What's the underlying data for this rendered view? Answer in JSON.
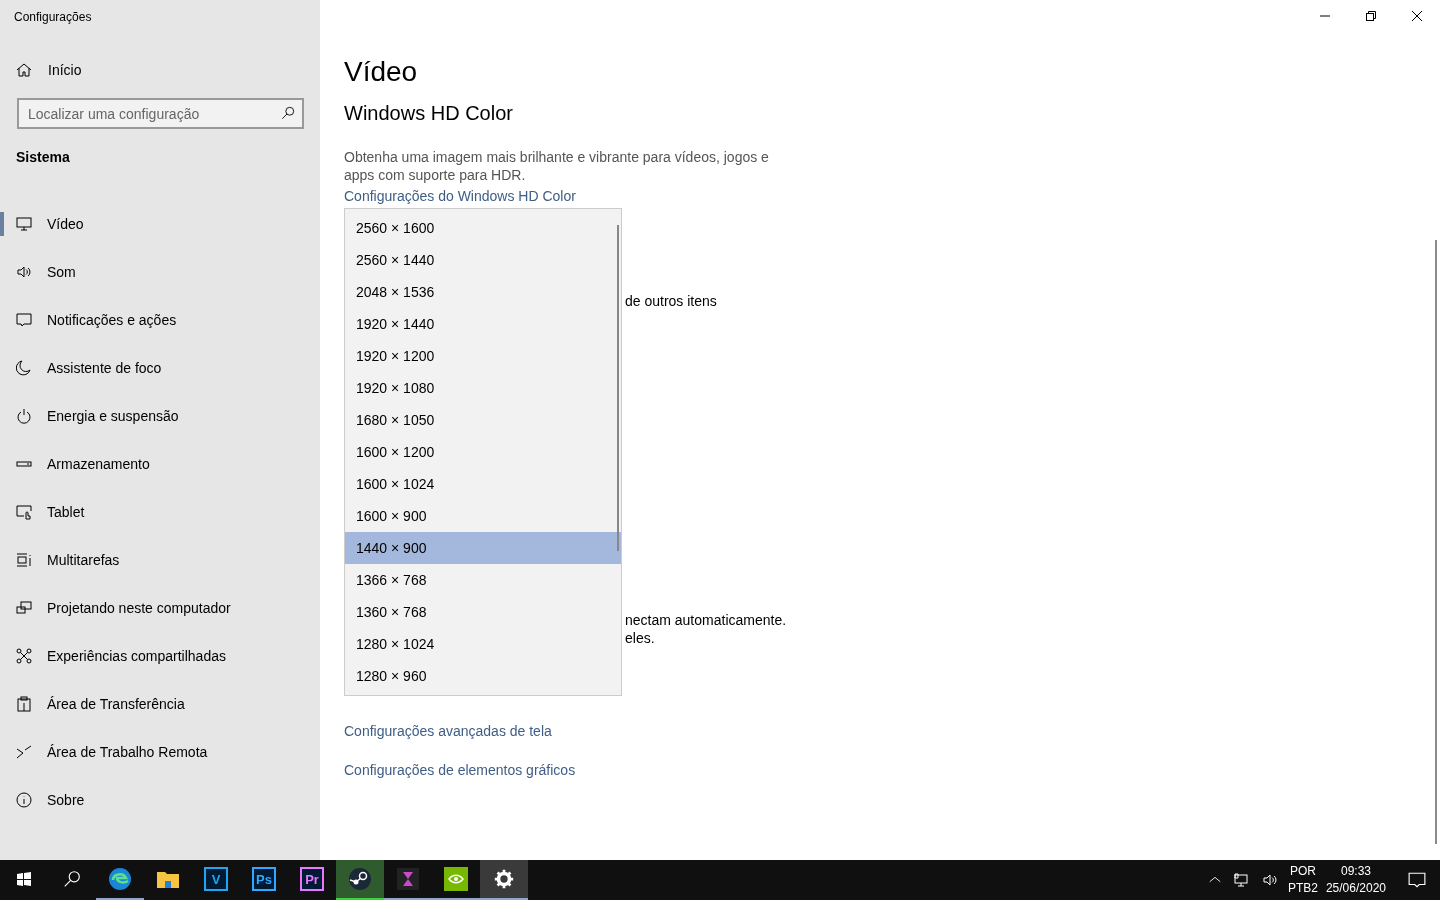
{
  "window": {
    "title": "Configurações"
  },
  "sidebar": {
    "home": "Início",
    "search": {
      "placeholder": "Localizar uma configuração"
    },
    "section": "Sistema",
    "items": [
      {
        "label": "Vídeo",
        "selected": true
      },
      {
        "label": "Som",
        "selected": false
      },
      {
        "label": "Notificações e ações",
        "selected": false
      },
      {
        "label": "Assistente de foco",
        "selected": false
      },
      {
        "label": "Energia e suspensão",
        "selected": false
      },
      {
        "label": "Armazenamento",
        "selected": false
      },
      {
        "label": "Tablet",
        "selected": false
      },
      {
        "label": "Multitarefas",
        "selected": false
      },
      {
        "label": "Projetando neste computador",
        "selected": false
      },
      {
        "label": "Experiências compartilhadas",
        "selected": false
      },
      {
        "label": "Área de Transferência",
        "selected": false
      },
      {
        "label": "Área de Trabalho Remota",
        "selected": false
      },
      {
        "label": "Sobre",
        "selected": false
      }
    ]
  },
  "page": {
    "title": "Vídeo",
    "section": "Windows HD Color",
    "description": "Obtenha uma imagem mais brilhante e vibrante para vídeos, jogos e apps com suporte para HDR.",
    "hd_link": "Configurações do Windows HD Color",
    "partial_text_1": "de outros itens",
    "partial_text_2": "nectam automaticamente.",
    "partial_text_3": "eles.",
    "links": [
      "Configurações avançadas de tela",
      "Configurações de elementos gráficos"
    ]
  },
  "resolution_dropdown": {
    "options": [
      {
        "label": "2560 × 1600",
        "selected": false
      },
      {
        "label": "2560 × 1440",
        "selected": false
      },
      {
        "label": "2048 × 1536",
        "selected": false
      },
      {
        "label": "1920 × 1440",
        "selected": false
      },
      {
        "label": "1920 × 1200",
        "selected": false
      },
      {
        "label": "1920 × 1080",
        "selected": false
      },
      {
        "label": "1680 × 1050",
        "selected": false
      },
      {
        "label": "1600 × 1200",
        "selected": false
      },
      {
        "label": "1600 × 1024",
        "selected": false
      },
      {
        "label": "1600 × 900",
        "selected": false
      },
      {
        "label": "1440 × 900",
        "selected": true
      },
      {
        "label": "1366 × 768",
        "selected": false
      },
      {
        "label": "1360 × 768",
        "selected": false
      },
      {
        "label": "1280 × 1024",
        "selected": false
      },
      {
        "label": "1280 × 960",
        "selected": false
      }
    ]
  },
  "taskbar": {
    "apps": [
      {
        "kind": "edge",
        "running": true,
        "selected": false
      },
      {
        "kind": "folder",
        "running": false,
        "selected": false
      },
      {
        "kind": "lettered",
        "glyph": "V",
        "color": "#1ea7f0",
        "running": false,
        "selected": false
      },
      {
        "kind": "lettered",
        "glyph": "Ps",
        "color": "#31a8ff",
        "running": false,
        "selected": false
      },
      {
        "kind": "lettered",
        "glyph": "Pr",
        "color": "#ea77ff",
        "running": false,
        "selected": false
      },
      {
        "kind": "steam",
        "running": true,
        "attention": true,
        "selected": false
      },
      {
        "kind": "hourglass",
        "running": true,
        "selected": false
      },
      {
        "kind": "nvidia",
        "running": true,
        "selected": false
      },
      {
        "kind": "gear",
        "running": true,
        "selected": true
      }
    ],
    "language": "POR",
    "layout": "PTB2",
    "time": "09:33",
    "date": "25/06/2020"
  }
}
